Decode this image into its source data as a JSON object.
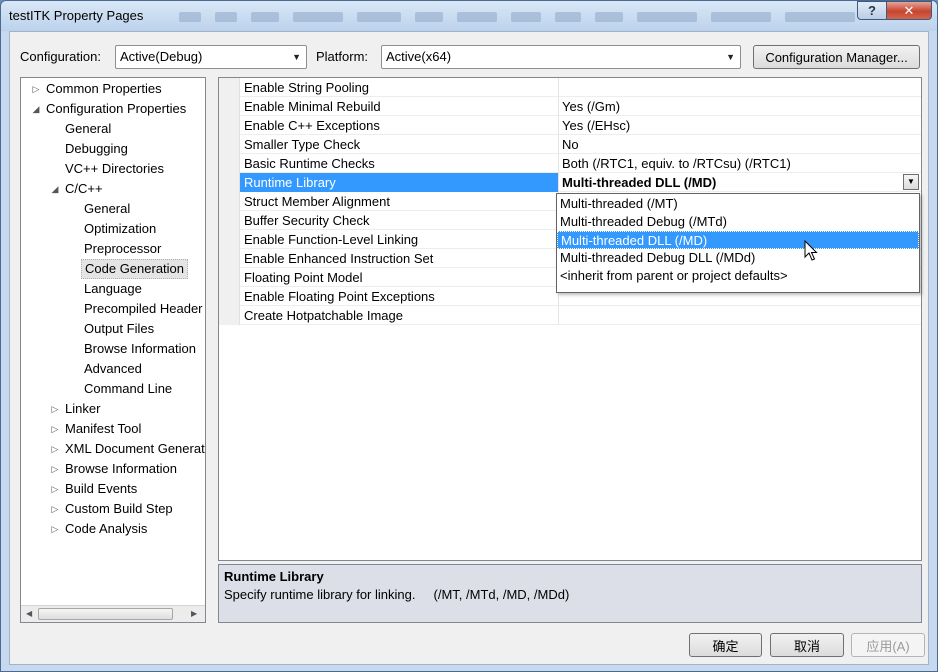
{
  "window": {
    "title": "testITK Property Pages",
    "help_glyph": "?",
    "close_glyph": "✕"
  },
  "config": {
    "configuration_label": "Configuration:",
    "configuration_value": "Active(Debug)",
    "platform_label": "Platform:",
    "platform_value": "Active(x64)",
    "manager_button": "Configuration Manager..."
  },
  "tree": {
    "items": [
      {
        "label": "Common Properties",
        "level": 0,
        "twisty": "▷"
      },
      {
        "label": "Configuration Properties",
        "level": 0,
        "twisty": "◢"
      },
      {
        "label": "General",
        "level": 1,
        "twisty": ""
      },
      {
        "label": "Debugging",
        "level": 1,
        "twisty": ""
      },
      {
        "label": "VC++ Directories",
        "level": 1,
        "twisty": ""
      },
      {
        "label": "C/C++",
        "level": 1,
        "twisty": "◢"
      },
      {
        "label": "General",
        "level": 2,
        "twisty": ""
      },
      {
        "label": "Optimization",
        "level": 2,
        "twisty": ""
      },
      {
        "label": "Preprocessor",
        "level": 2,
        "twisty": ""
      },
      {
        "label": "Code Generation",
        "level": 2,
        "twisty": "",
        "selected": true
      },
      {
        "label": "Language",
        "level": 2,
        "twisty": ""
      },
      {
        "label": "Precompiled Header",
        "level": 2,
        "twisty": ""
      },
      {
        "label": "Output Files",
        "level": 2,
        "twisty": ""
      },
      {
        "label": "Browse Information",
        "level": 2,
        "twisty": ""
      },
      {
        "label": "Advanced",
        "level": 2,
        "twisty": ""
      },
      {
        "label": "Command Line",
        "level": 2,
        "twisty": ""
      },
      {
        "label": "Linker",
        "level": 1,
        "twisty": "▷"
      },
      {
        "label": "Manifest Tool",
        "level": 1,
        "twisty": "▷"
      },
      {
        "label": "XML Document Generat",
        "level": 1,
        "twisty": "▷"
      },
      {
        "label": "Browse Information",
        "level": 1,
        "twisty": "▷"
      },
      {
        "label": "Build Events",
        "level": 1,
        "twisty": "▷"
      },
      {
        "label": "Custom Build Step",
        "level": 1,
        "twisty": "▷"
      },
      {
        "label": "Code Analysis",
        "level": 1,
        "twisty": "▷"
      }
    ],
    "scroll_left": "◀",
    "scroll_right": "▶"
  },
  "properties": [
    {
      "name": "Enable String Pooling",
      "value": ""
    },
    {
      "name": "Enable Minimal Rebuild",
      "value": "Yes (/Gm)"
    },
    {
      "name": "Enable C++ Exceptions",
      "value": "Yes (/EHsc)"
    },
    {
      "name": "Smaller Type Check",
      "value": "No"
    },
    {
      "name": "Basic Runtime Checks",
      "value": "Both (/RTC1, equiv. to /RTCsu) (/RTC1)"
    },
    {
      "name": "Runtime Library",
      "value": "Multi-threaded DLL (/MD)",
      "selected": true
    },
    {
      "name": "Struct Member Alignment",
      "value": ""
    },
    {
      "name": "Buffer Security Check",
      "value": ""
    },
    {
      "name": "Enable Function-Level Linking",
      "value": ""
    },
    {
      "name": "Enable Enhanced Instruction Set",
      "value": ""
    },
    {
      "name": "Floating Point Model",
      "value": ""
    },
    {
      "name": "Enable Floating Point Exceptions",
      "value": ""
    },
    {
      "name": "Create Hotpatchable Image",
      "value": ""
    }
  ],
  "dropdown": {
    "options": [
      "Multi-threaded (/MT)",
      "Multi-threaded Debug (/MTd)",
      "Multi-threaded DLL (/MD)",
      "Multi-threaded Debug DLL (/MDd)",
      "<inherit from parent or project defaults>"
    ],
    "highlighted_index": 2
  },
  "description": {
    "title": "Runtime Library",
    "text": "Specify runtime library for linking.     (/MT, /MTd, /MD, /MDd)"
  },
  "buttons": {
    "ok": "确定",
    "cancel": "取消",
    "apply": "应用(A)"
  },
  "icons": {
    "combo_arrow": "▼",
    "cursor": "arrow-pointer"
  }
}
